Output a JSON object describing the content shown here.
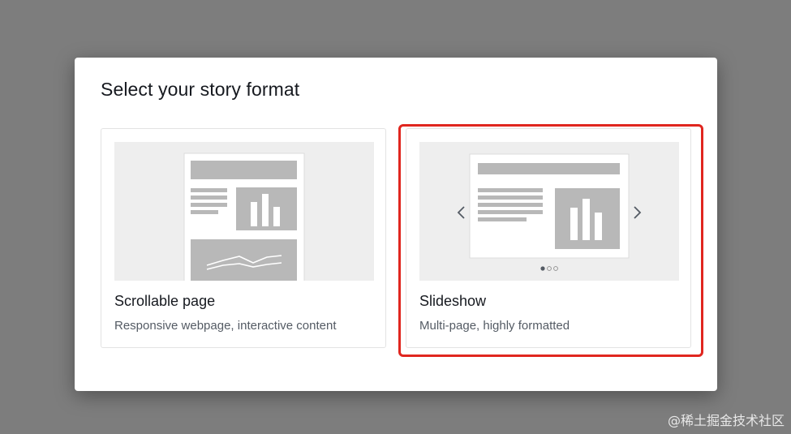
{
  "dialog": {
    "title": "Select your story format"
  },
  "options": [
    {
      "title": "Scrollable page",
      "description": "Responsive webpage, interactive content",
      "selected": false
    },
    {
      "title": "Slideshow",
      "description": "Multi-page, highly formatted",
      "selected": true
    }
  ],
  "colors": {
    "selection_outline": "#e0261f",
    "preview_bg": "#eeeeee",
    "placeholder_block": "#b8b8b8"
  },
  "watermark": "@稀土掘金技术社区"
}
